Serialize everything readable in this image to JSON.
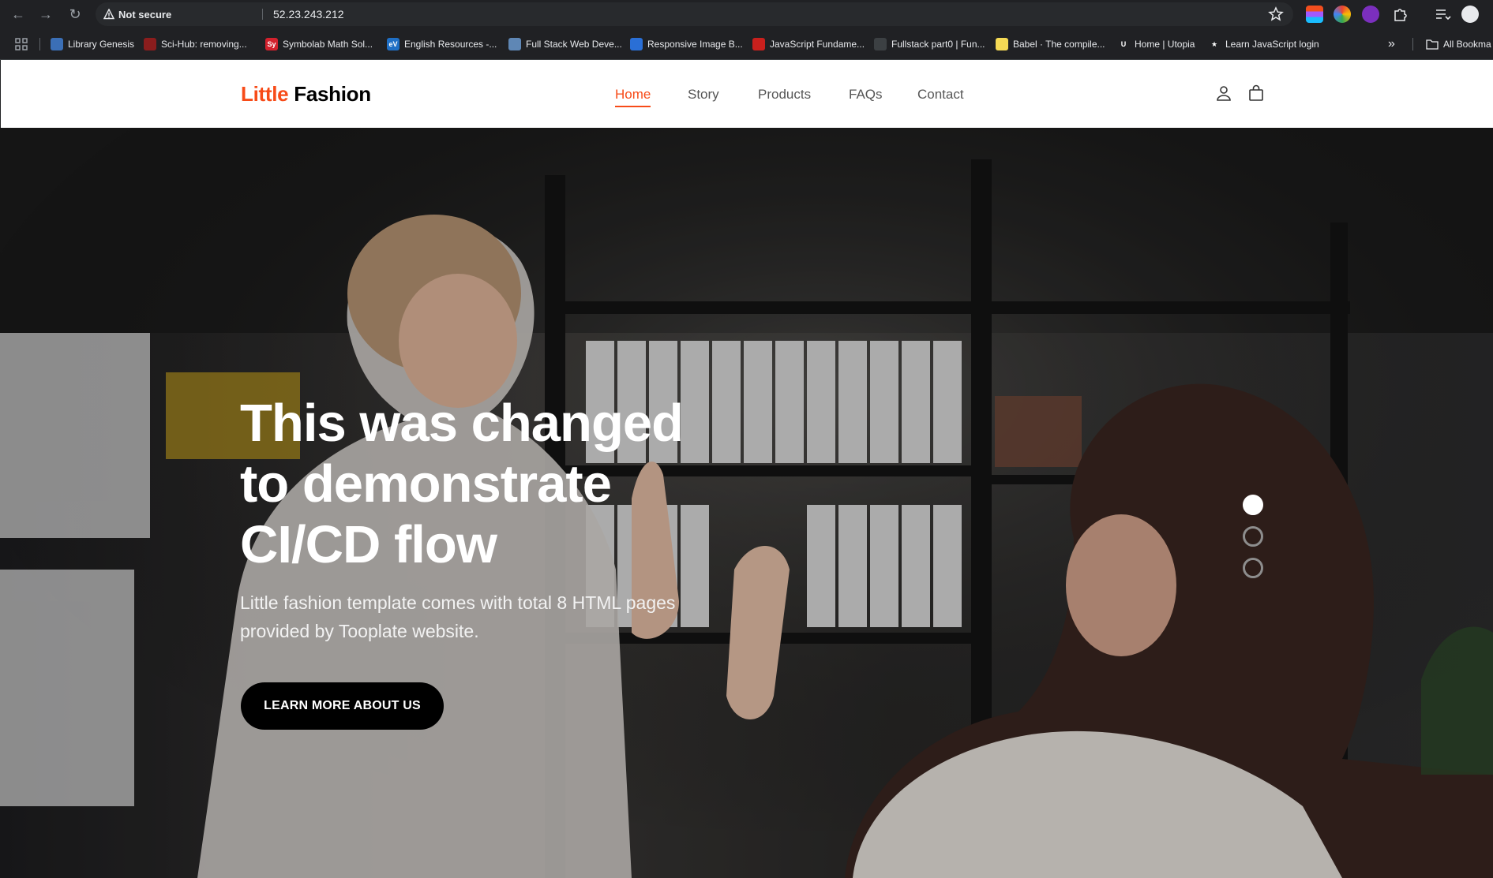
{
  "browser": {
    "security_label": "Not secure",
    "url": "52.23.243.212",
    "bookmarks": [
      {
        "label": "Library Genesis",
        "fav_color": "#3b6fb6",
        "fav_text": ""
      },
      {
        "label": "Sci-Hub: removing...",
        "fav_color": "#8b1d1d",
        "fav_text": ""
      },
      {
        "label": "Symbolab Math Sol...",
        "fav_color": "#d3212d",
        "fav_text": "Sy"
      },
      {
        "label": "English Resources -...",
        "fav_color": "#1f6fc5",
        "fav_text": "eV"
      },
      {
        "label": "Full Stack Web Deve...",
        "fav_color": "#5f87b5",
        "fav_text": ""
      },
      {
        "label": "Responsive Image B...",
        "fav_color": "#2a6fd6",
        "fav_text": ""
      },
      {
        "label": "JavaScript Fundame...",
        "fav_color": "#c9201d",
        "fav_text": ""
      },
      {
        "label": "Fullstack part0 | Fun...",
        "fav_color": "#3c4043",
        "fav_text": ""
      },
      {
        "label": "Babel · The compile...",
        "fav_color": "#f5da55",
        "fav_text": ""
      },
      {
        "label": "Home | Utopia",
        "fav_color": "#202124",
        "fav_text": "U"
      },
      {
        "label": "Learn JavaScript login",
        "fav_color": "#202124",
        "fav_text": "★"
      }
    ],
    "all_bookmarks_label": "All Bookma",
    "colors": {
      "chrome_bg": "#202124",
      "omnibox_bg": "#282a2d"
    }
  },
  "site": {
    "logo_accent": "Little",
    "logo_rest": "Fashion",
    "accent_color": "#f74b18",
    "nav": [
      {
        "label": "Home",
        "active": true
      },
      {
        "label": "Story",
        "active": false
      },
      {
        "label": "Products",
        "active": false
      },
      {
        "label": "FAQs",
        "active": false
      },
      {
        "label": "Contact",
        "active": false
      }
    ],
    "icons": [
      "user-icon",
      "shopping-bag-icon"
    ]
  },
  "hero": {
    "title_line1": "This was changed",
    "title_line2": "to demonstrate",
    "title_line3": "CI/CD flow",
    "subtitle_line1": "Little fashion template comes with total 8 HTML pages",
    "subtitle_line2": "provided by Tooplate website.",
    "button_label": "LEARN MORE ABOUT US",
    "slides": 3,
    "active_slide": 1
  }
}
